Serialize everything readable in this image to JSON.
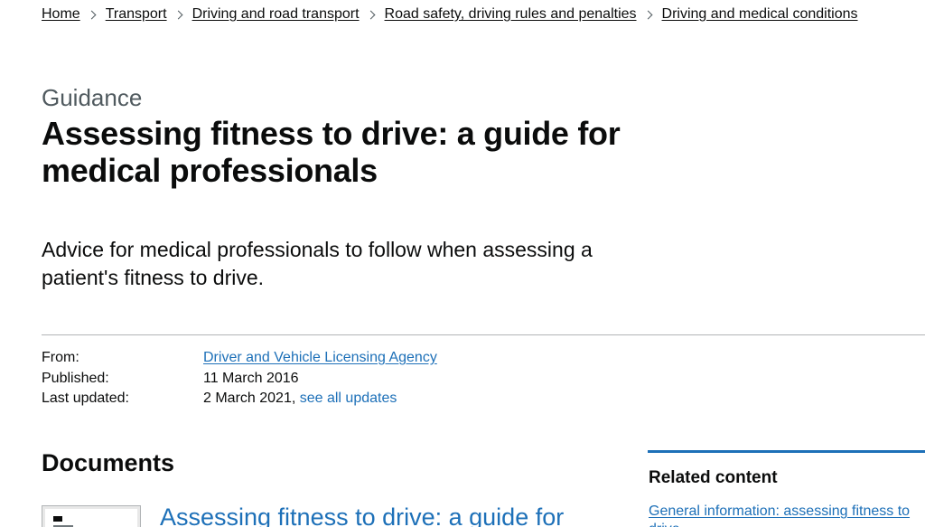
{
  "breadcrumbs": [
    {
      "label": "Home"
    },
    {
      "label": "Transport"
    },
    {
      "label": "Driving and road transport"
    },
    {
      "label": "Road safety, driving rules and penalties"
    },
    {
      "label": "Driving and medical conditions"
    }
  ],
  "header": {
    "caption": "Guidance",
    "title": "Assessing fitness to drive: a guide for medical professionals",
    "lede": "Advice for medical professionals to follow when assessing a patient's fitness to drive."
  },
  "metadata": {
    "from_label": "From:",
    "from_value": "Driver and Vehicle Licensing Agency",
    "published_label": "Published:",
    "published_value": "11 March 2016",
    "updated_label": "Last updated:",
    "updated_value": "2 March 2021,",
    "see_all_updates": "see all updates"
  },
  "documents": {
    "heading": "Documents",
    "items": [
      {
        "title": "Assessing fitness to drive: a guide for"
      }
    ]
  },
  "related": {
    "heading": "Related content",
    "links": [
      {
        "label": "General information: assessing fitness to drive"
      }
    ]
  },
  "colors": {
    "link": "#1d70b8",
    "text": "#0b0c0c",
    "secondary_text": "#505a5f",
    "divider": "#b1b4b6"
  }
}
